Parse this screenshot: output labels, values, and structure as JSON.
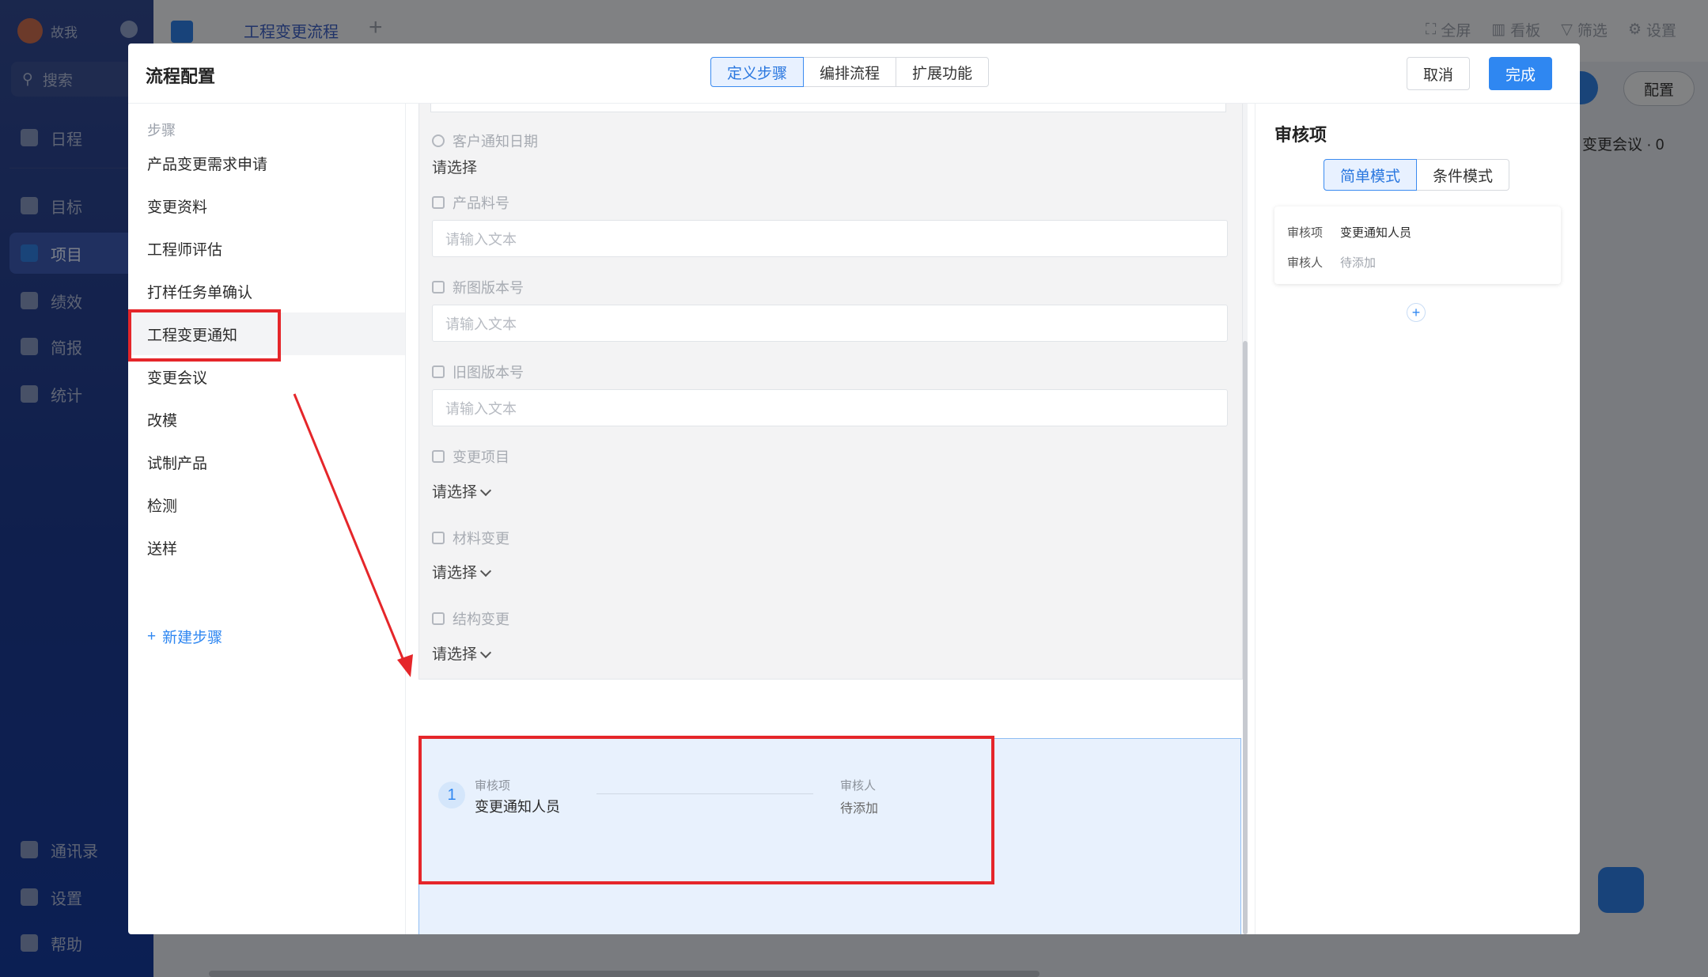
{
  "app": {
    "user_name": "故我",
    "search_label": "搜索",
    "nav": [
      "日程",
      "目标",
      "项目",
      "绩效",
      "简报",
      "统计"
    ],
    "nav_bottom": [
      "通讯录",
      "设置",
      "帮助"
    ],
    "project_title": "工程变更流程",
    "toolbar": [
      "全屏",
      "看板",
      "筛选",
      "设置"
    ],
    "config_label": "配置",
    "side_text": "变更会议",
    "side_count": "0"
  },
  "modal": {
    "title": "流程配置",
    "tabs": [
      "定义步骤",
      "编排流程",
      "扩展功能"
    ],
    "cancel_label": "取消",
    "done_label": "完成"
  },
  "steps": {
    "header": "步骤",
    "items": [
      "产品变更需求申请",
      "变更资料",
      "工程师评估",
      "打样任务单确认",
      "工程变更通知",
      "变更会议",
      "改模",
      "试制产品",
      "检测",
      "送样"
    ],
    "new_step_label": "新建步骤"
  },
  "form": {
    "fields": [
      {
        "label": "客户通知日期",
        "value": "请选择"
      },
      {
        "label": "产品料号",
        "placeholder": "请输入文本"
      },
      {
        "label": "新图版本号",
        "placeholder": "请输入文本"
      },
      {
        "label": "旧图版本号",
        "placeholder": "请输入文本"
      },
      {
        "label": "变更项目",
        "value": "请选择"
      },
      {
        "label": "材料变更",
        "value": "请选择"
      },
      {
        "label": "结构变更",
        "value": "请选择"
      }
    ]
  },
  "approval": {
    "number": "1",
    "item_label": "审核项",
    "item_value": "变更通知人员",
    "approver_label": "审核人",
    "approver_value": "待添加"
  },
  "right_panel": {
    "title": "审核项",
    "modes": [
      "简单模式",
      "条件模式"
    ],
    "card": {
      "item_key": "审核项",
      "item_value": "变更通知人员",
      "approver_key": "审核人",
      "approver_value": "待添加"
    },
    "add_symbol": "+"
  },
  "colors": {
    "primary": "#2f87f1",
    "highlight_red": "#e5262a",
    "sidebar": "#1d3a8f"
  }
}
